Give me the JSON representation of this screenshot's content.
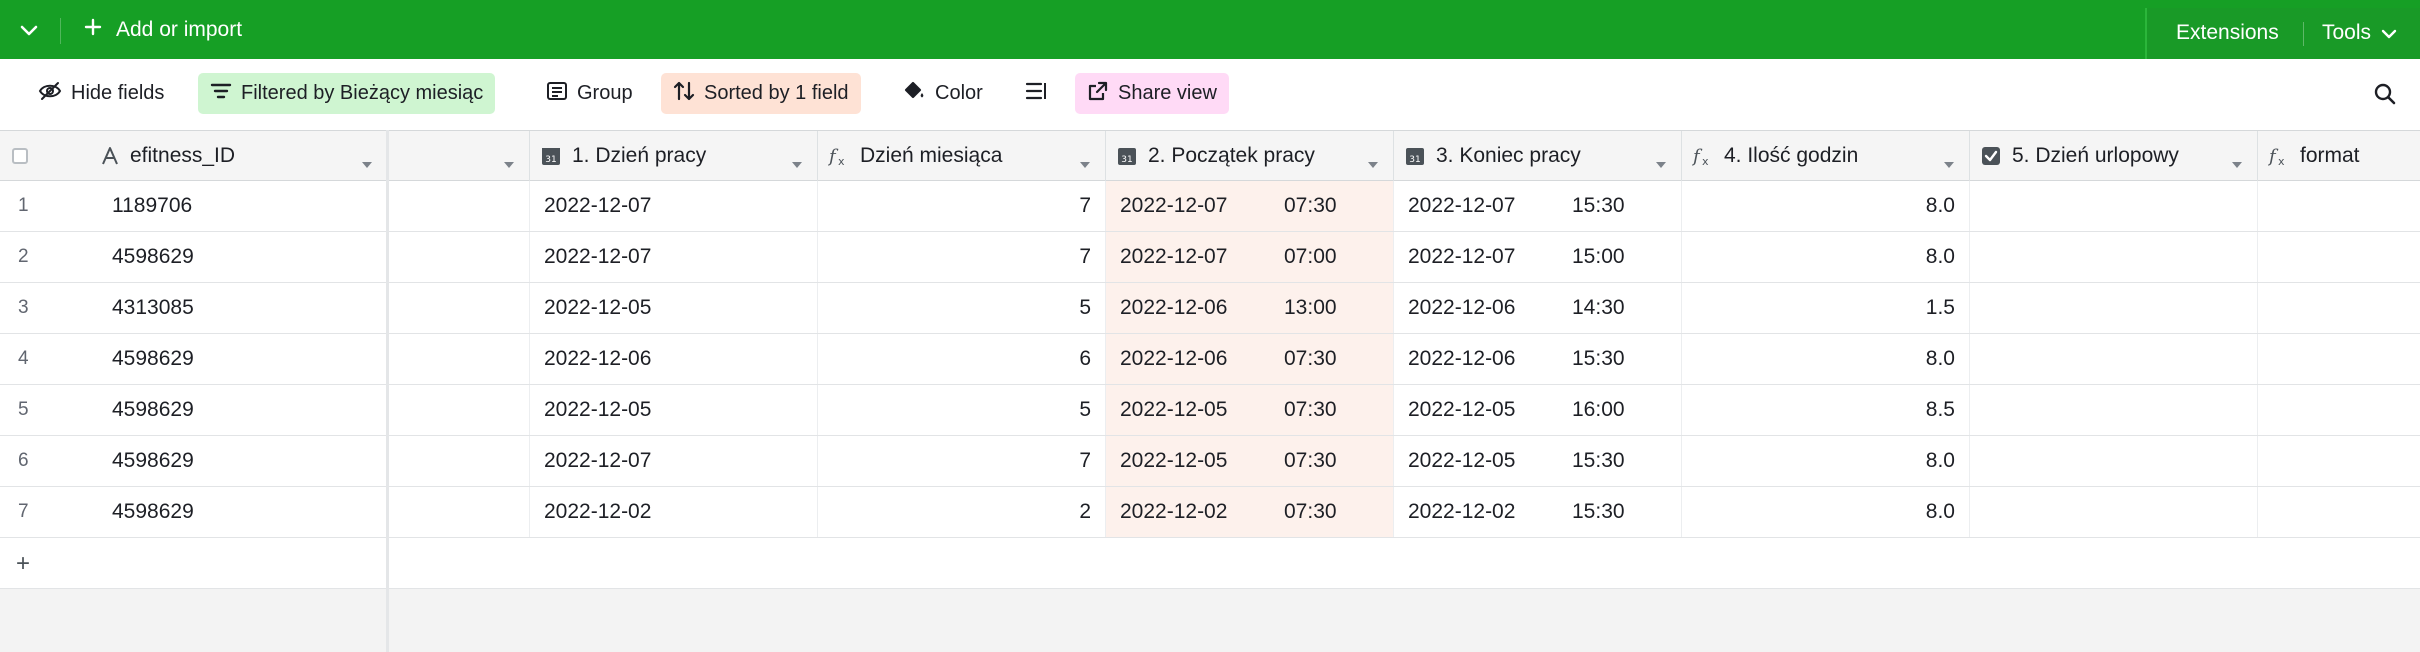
{
  "topbar": {
    "add_label": "Add or import",
    "extensions_label": "Extensions",
    "tools_label": "Tools"
  },
  "toolbar": {
    "hide_fields": "Hide fields",
    "filter": "Filtered by Bieżący miesiąc",
    "group": "Group",
    "sort": "Sorted by 1 field",
    "color": "Color",
    "share": "Share view"
  },
  "columns": {
    "primary": "efitness_ID",
    "dzien_pracy": "1. Dzień pracy",
    "dzien_miesiaca": "Dzień miesiąca",
    "poczatek": "2. Początek pracy",
    "koniec": "3. Koniec pracy",
    "ilosc": "4. Ilość godzin",
    "urlopowy": "5. Dzień urlopowy",
    "format": "format"
  },
  "rows": [
    {
      "n": "1",
      "id": "1189706",
      "dzien_pracy": "2022-12-07",
      "dzien_miesiaca": "7",
      "p_date": "2022-12-07",
      "p_time": "07:30",
      "k_date": "2022-12-07",
      "k_time": "15:30",
      "ilosc": "8.0"
    },
    {
      "n": "2",
      "id": "4598629",
      "dzien_pracy": "2022-12-07",
      "dzien_miesiaca": "7",
      "p_date": "2022-12-07",
      "p_time": "07:00",
      "k_date": "2022-12-07",
      "k_time": "15:00",
      "ilosc": "8.0"
    },
    {
      "n": "3",
      "id": "4313085",
      "dzien_pracy": "2022-12-05",
      "dzien_miesiaca": "5",
      "p_date": "2022-12-06",
      "p_time": "13:00",
      "k_date": "2022-12-06",
      "k_time": "14:30",
      "ilosc": "1.5"
    },
    {
      "n": "4",
      "id": "4598629",
      "dzien_pracy": "2022-12-06",
      "dzien_miesiaca": "6",
      "p_date": "2022-12-06",
      "p_time": "07:30",
      "k_date": "2022-12-06",
      "k_time": "15:30",
      "ilosc": "8.0"
    },
    {
      "n": "5",
      "id": "4598629",
      "dzien_pracy": "2022-12-05",
      "dzien_miesiaca": "5",
      "p_date": "2022-12-05",
      "p_time": "07:30",
      "k_date": "2022-12-05",
      "k_time": "16:00",
      "ilosc": "8.5"
    },
    {
      "n": "6",
      "id": "4598629",
      "dzien_pracy": "2022-12-07",
      "dzien_miesiaca": "7",
      "p_date": "2022-12-05",
      "p_time": "07:30",
      "k_date": "2022-12-05",
      "k_time": "15:30",
      "ilosc": "8.0"
    },
    {
      "n": "7",
      "id": "4598629",
      "dzien_pracy": "2022-12-02",
      "dzien_miesiaca": "2",
      "p_date": "2022-12-02",
      "p_time": "07:30",
      "k_date": "2022-12-02",
      "k_time": "15:30",
      "ilosc": "8.0"
    }
  ],
  "add_row_label": "+",
  "colors": {
    "topbar": "#169f25",
    "filter_bg": "#cff5d1",
    "sort_bg": "#fee2d5",
    "share_bg": "#ffdaf6",
    "sorted_column_bg": "#fdf1ec"
  },
  "icons": {
    "topbar_menu": "chevron-down-icon",
    "add": "plus-icon",
    "tools_menu": "chevron-down-icon",
    "hide_fields": "eye-slash-icon",
    "filter": "filter-icon",
    "group": "group-list-icon",
    "sort": "sort-arrows-icon",
    "color": "paint-bucket-icon",
    "row_height": "row-height-icon",
    "share": "share-external-icon",
    "search": "search-icon",
    "text_field": "text-field-icon",
    "date_field": "calendar-icon",
    "formula_field": "formula-icon",
    "checkbox_field": "checkbox-field-icon",
    "column_menu": "chevron-down-icon"
  }
}
